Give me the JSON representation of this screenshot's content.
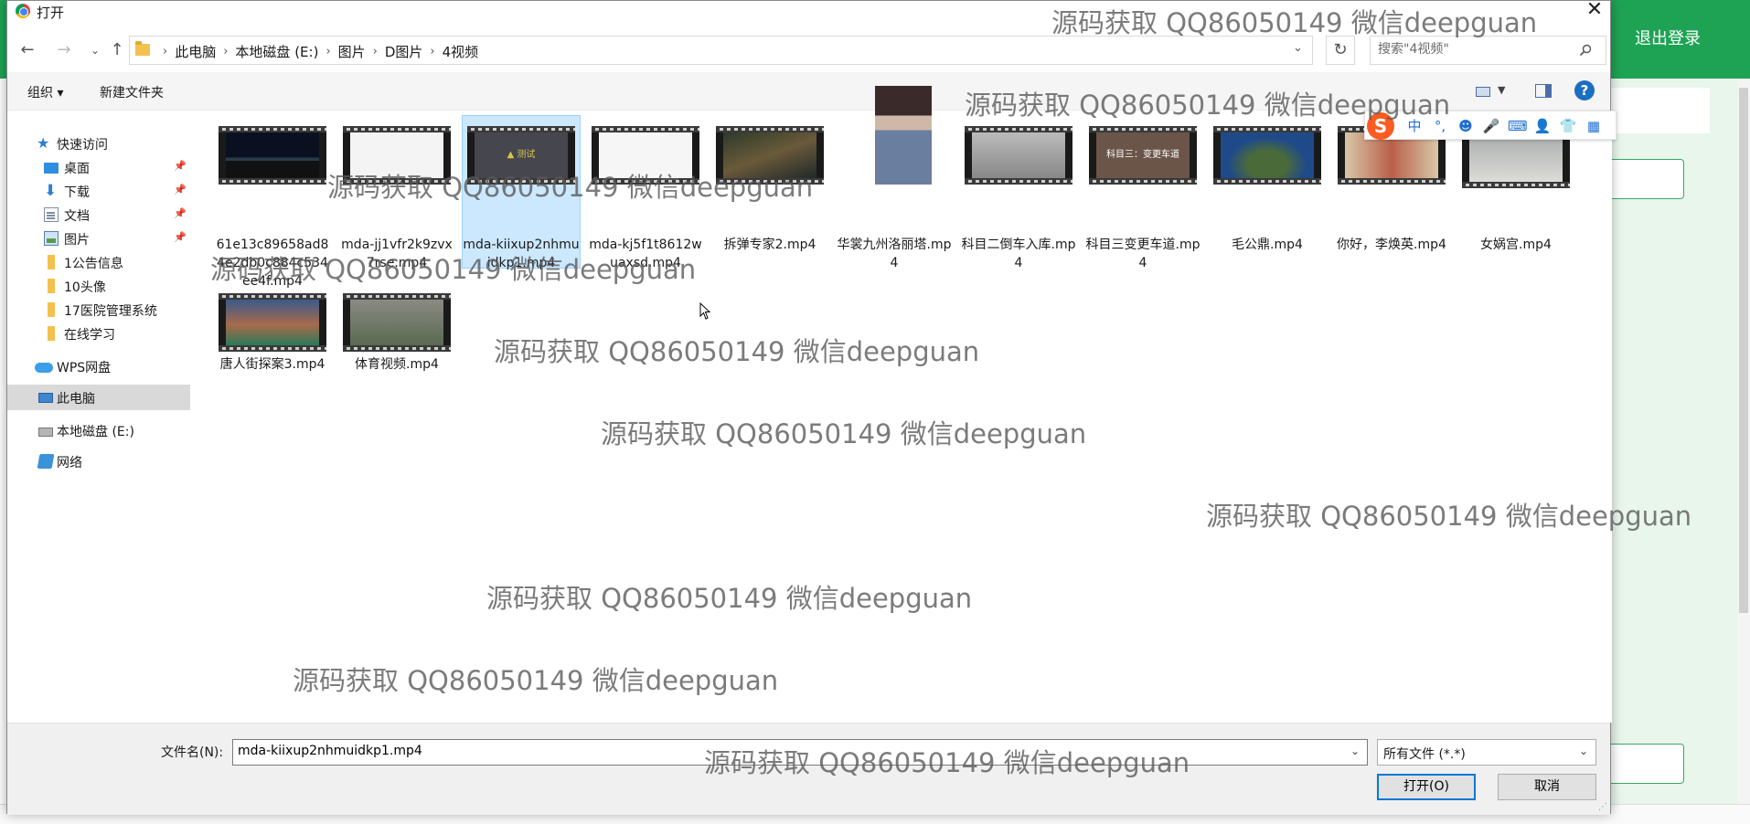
{
  "background_app": {
    "logout_label": "退出登录",
    "header_color": "#1ea355"
  },
  "dialog": {
    "title": "打开",
    "close_glyph": "✕",
    "address_crumbs": [
      "此电脑",
      "本地磁盘 (E:)",
      "图片",
      "D图片",
      "4视频"
    ],
    "search_placeholder": "搜索\"4视频\"",
    "toolbar": {
      "organize_label": "组织 ▾",
      "new_folder_label": "新建文件夹",
      "help_glyph": "?"
    },
    "nav": {
      "quick_access": "快速访问",
      "quick_items": [
        "桌面",
        "下载",
        "文档",
        "图片"
      ],
      "folders": [
        "1公告信息",
        "10头像",
        "17医院管理系统",
        "在线学习"
      ],
      "wps": "WPS网盘",
      "this_pc": "此电脑",
      "local_disk": "本地磁盘 (E:)",
      "network": "网络"
    },
    "files": [
      {
        "name": "61e13c89658ad84e2db0c884c534ee4f.mp4",
        "selected": false
      },
      {
        "name": "mda-jj1vfr2k9zvx7rse.mp4",
        "selected": false
      },
      {
        "name": "mda-kiixup2nhmuidkp1.mp4",
        "selected": true
      },
      {
        "name": "mda-kj5f1t8612wuaxsd.mp4",
        "selected": false
      },
      {
        "name": "拆弹专家2.mp4",
        "selected": false
      },
      {
        "name": "华裳九州洛丽塔.mp4",
        "selected": false
      },
      {
        "name": "科目二倒车入库.mp4",
        "selected": false
      },
      {
        "name": "科目三变更车道.mp4",
        "selected": false
      },
      {
        "name": "毛公鼎.mp4",
        "selected": false
      },
      {
        "name": "你好，李焕英.mp4",
        "selected": false
      },
      {
        "name": "女娲宫.mp4",
        "selected": false
      },
      {
        "name": "唐人街探案3.mp4",
        "selected": false
      },
      {
        "name": "体育视频.mp4",
        "selected": false
      }
    ],
    "thumb_captions": {
      "kemu3": "科目三：变更车道",
      "selected_mini": "▲ 测试"
    },
    "bottom": {
      "filename_label": "文件名(N):",
      "filename_value": "mda-kiixup2nhmuidkp1.mp4",
      "filter_value": "所有文件 (*.*)",
      "open_label": "打开(O)",
      "cancel_label": "取消"
    }
  },
  "ime": {
    "logo": "S",
    "icons": [
      "中",
      "°,",
      "☻",
      "🎤",
      "⌨",
      "👤",
      "👕",
      "▦"
    ]
  },
  "watermark_text": "源码获取 QQ86050149 微信deepguan"
}
